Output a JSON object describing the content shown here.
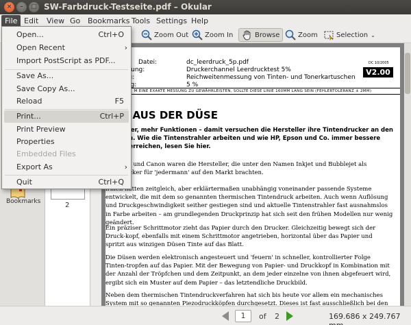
{
  "window": {
    "title": "SW-Farbdruck-Testseite.pdf – Okular",
    "close_glyph": "×",
    "min_glyph": "–",
    "max_glyph": "□"
  },
  "menubar": [
    "File",
    "Edit",
    "View",
    "Go",
    "Bookmarks",
    "Tools",
    "Settings",
    "Help"
  ],
  "toolbar": {
    "zoom_out": "Zoom Out",
    "zoom_in": "Zoom In",
    "browse": "Browse",
    "zoom": "Zoom",
    "selection": "Selection"
  },
  "file_menu": {
    "open": "Open...",
    "open_sc": "Ctrl+O",
    "open_recent": "Open Recent",
    "import_ps": "Import PostScript as PDF...",
    "save_as": "Save As...",
    "save_copy_as": "Save Copy As...",
    "reload": "Reload",
    "reload_sc": "F5",
    "print": "Print...",
    "print_sc": "Ctrl+P",
    "print_preview": "Print Preview",
    "properties": "Properties",
    "embedded_files": "Embedded Files",
    "export_as": "Export As",
    "quit": "Quit",
    "quit_sc": "Ctrl+Q"
  },
  "sidebar": {
    "bookmarks_label": "Bookmarks",
    "thumb_page_number": "2"
  },
  "document": {
    "meta": [
      {
        "k": "Datei:",
        "v": "dc_leerdruck_5p.pdf"
      },
      {
        "k": "zeichnung:",
        "v": "Druckerchannel Leerdrucktest 5%"
      },
      {
        "k": "endung:",
        "v": "Reichweitenmessung von Tinten- und Tonerkartuschen"
      },
      {
        "k": "deckung:",
        "v": "5 %"
      }
    ],
    "badge_date": "DC 10/2005",
    "badge": "V2.00",
    "notice": "M EINE EXAKTE MESSUNG ZU GEWÄHRLEISTEN, SOLLTE DIESE LINIE 160MM LANG SEIN (FEHLERTOLERANZ ± 2MM)",
    "headline": "DER AUS DER DÜSE",
    "lead": "er, besser, mehr Funktionen – damit versuchen die Hersteller ihre Tintendrucker an den  bringen. Wie die Tintenstrahler arbeiten und wie HP, Epson und Co. immer bessere ualität erreichen, lesen Sie hier.",
    "p1": "-Packard und Canon waren die Hersteller, die unter den Namen Inkjet und Bubblejet als ntendrucker für 'jedermann' auf den Markt brachten.",
    "p2": "irmen hatten zeitgleich, aber erklärtermaßen unabhängig voneinander passende Systeme entwickelt, die mit dem so genannten thermischen Tintendruck arbeiten. Auch wenn Auflösung und Druckgeschwindigkeit seither gestiegen sind und aktuelle Tintenstrahler fast ausnahmslos in Farbe arbeiten – am grundlegenden Druckprinzip hat sich seit den frühen Modellen nur wenig geändert.",
    "p3": "Ein präziser Schrittmotor zieht das Papier durch den Drucker. Gleichzeitig bewegt sich der Druck-kopf, ebenfalls mit einem Schrittmotor angetrieben, horizontal über das Papier und spritzt aus winzigen Düsen Tinte auf das Blatt.",
    "p4": "Die Düsen werden elektronisch angesteuert und 'feuern' in schneller, kontrollierter Folge Tinten-tropfen auf das Papier. Mit der Bewegung von Papier- und Druckkopf in Kombination mit der Anzahl der Tröpfchen und dem Zeitpunkt, an dem jeder einzelne von ihnen abgefeuert wird, ergibt sich ein Muster auf dem Papier – das letztendliche Druckbild.",
    "p5": "Neben dem thermischen Tintendruckverfahren hat sich bis heute vor allem ein mechanisches System mit so genannten Piezodruckköpfen durchgesetzt. Dieses ist fast ausschließlich bei den"
  },
  "statusbar": {
    "current_page": "1",
    "of_label": "of",
    "total_pages": "2",
    "page_size": "169.686 x 249.767 mm"
  },
  "icons": [
    "zoom-out-icon",
    "zoom-in-icon",
    "browse-hand-icon",
    "zoom-icon",
    "selection-icon",
    "bookmarks-icon",
    "prev-page-icon",
    "next-page-icon"
  ],
  "colors": {
    "titlebar": "#3c3b37",
    "menu_open": "#4a4a4a",
    "next_arrow": "#3a9a23"
  }
}
